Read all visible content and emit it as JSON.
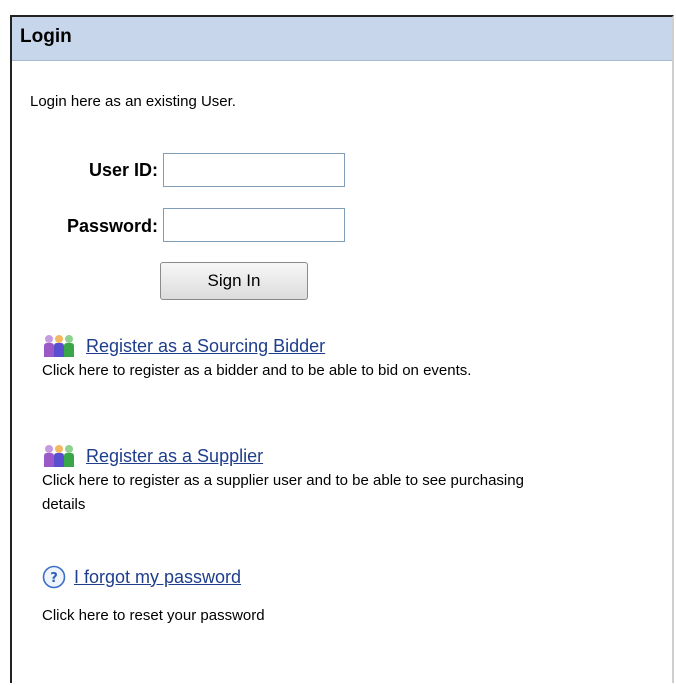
{
  "header": {
    "title": "Login"
  },
  "intro": "Login here as an existing User.",
  "form": {
    "user_id_label": "User ID:",
    "user_id_value": "",
    "password_label": "Password:",
    "password_value": "",
    "signin_label": "Sign In"
  },
  "links": {
    "bidder": {
      "label": "Register as a Sourcing Bidder",
      "description": "Click here to register as a bidder and to be able to bid on events.",
      "icon": "people-icon"
    },
    "supplier": {
      "label": "Register as a Supplier",
      "description": "Click here to register as a supplier user and to be able to see purchasing details",
      "icon": "people-icon"
    },
    "forgot": {
      "label": "I forgot my password",
      "description": "Click here to reset your password",
      "icon": "help-icon"
    }
  },
  "colors": {
    "header_bg": "#c7d6eb",
    "link": "#1e3e8c"
  }
}
